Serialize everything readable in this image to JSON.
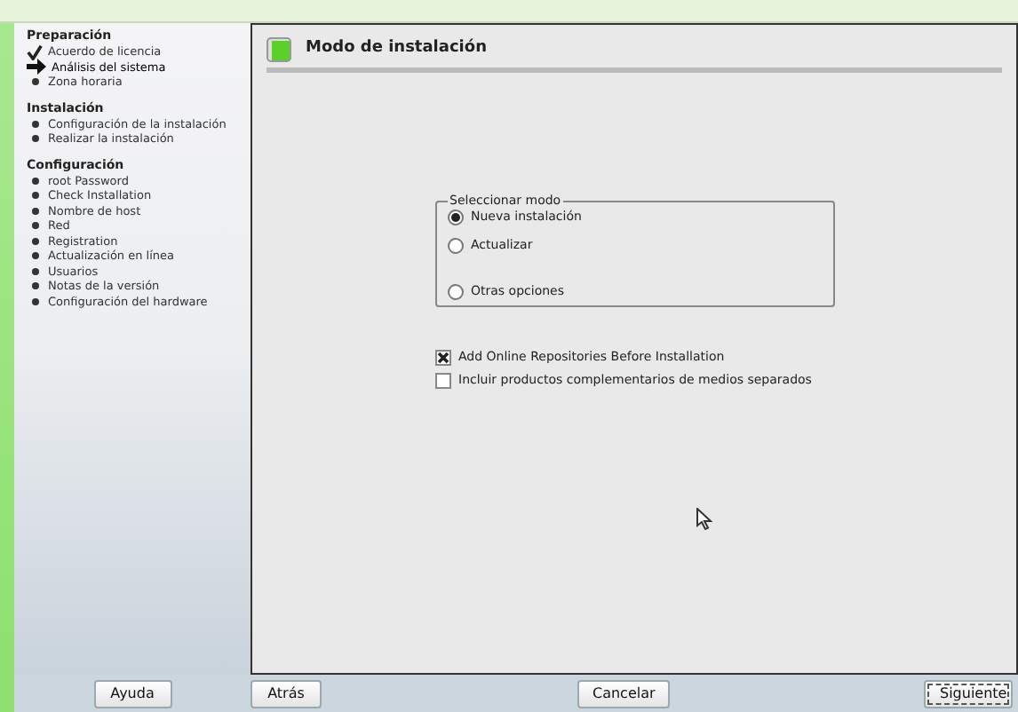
{
  "sidebar": {
    "sections": [
      {
        "title": "Preparación",
        "items": [
          {
            "label": "Acuerdo de licencia",
            "kind": "done"
          },
          {
            "label": "Análisis del sistema",
            "kind": "current"
          },
          {
            "label": "Zona horaria",
            "kind": "pending"
          }
        ]
      },
      {
        "title": "Instalación",
        "items": [
          {
            "label": "Configuración de la instalación",
            "kind": "pending"
          },
          {
            "label": "Realizar la instalación",
            "kind": "pending"
          }
        ]
      },
      {
        "title": "Configuración",
        "items": [
          {
            "label": "root Password",
            "kind": "pending"
          },
          {
            "label": "Check Installation",
            "kind": "pending"
          },
          {
            "label": "Nombre de host",
            "kind": "pending"
          },
          {
            "label": "Red",
            "kind": "pending"
          },
          {
            "label": "Registration",
            "kind": "pending"
          },
          {
            "label": "Actualización en línea",
            "kind": "pending"
          },
          {
            "label": "Usuarios",
            "kind": "pending"
          },
          {
            "label": "Notas de la versión",
            "kind": "pending"
          },
          {
            "label": "Configuración del hardware",
            "kind": "pending"
          }
        ]
      }
    ]
  },
  "page": {
    "title": "Modo de instalación"
  },
  "mode_group": {
    "legend": "Seleccionar modo",
    "options": [
      {
        "label": "Nueva instalación",
        "selected": true
      },
      {
        "label": "Actualizar",
        "selected": false
      },
      {
        "label": "Otras opciones",
        "selected": false
      }
    ]
  },
  "checkboxes": [
    {
      "label": "Add Online Repositories Before Installation",
      "checked": true
    },
    {
      "label": "Incluir productos complementarios de medios separados",
      "checked": false
    }
  ],
  "buttons": {
    "help": "Ayuda",
    "back": "Atrás",
    "cancel": "Cancelar",
    "next": "Siguiente"
  }
}
